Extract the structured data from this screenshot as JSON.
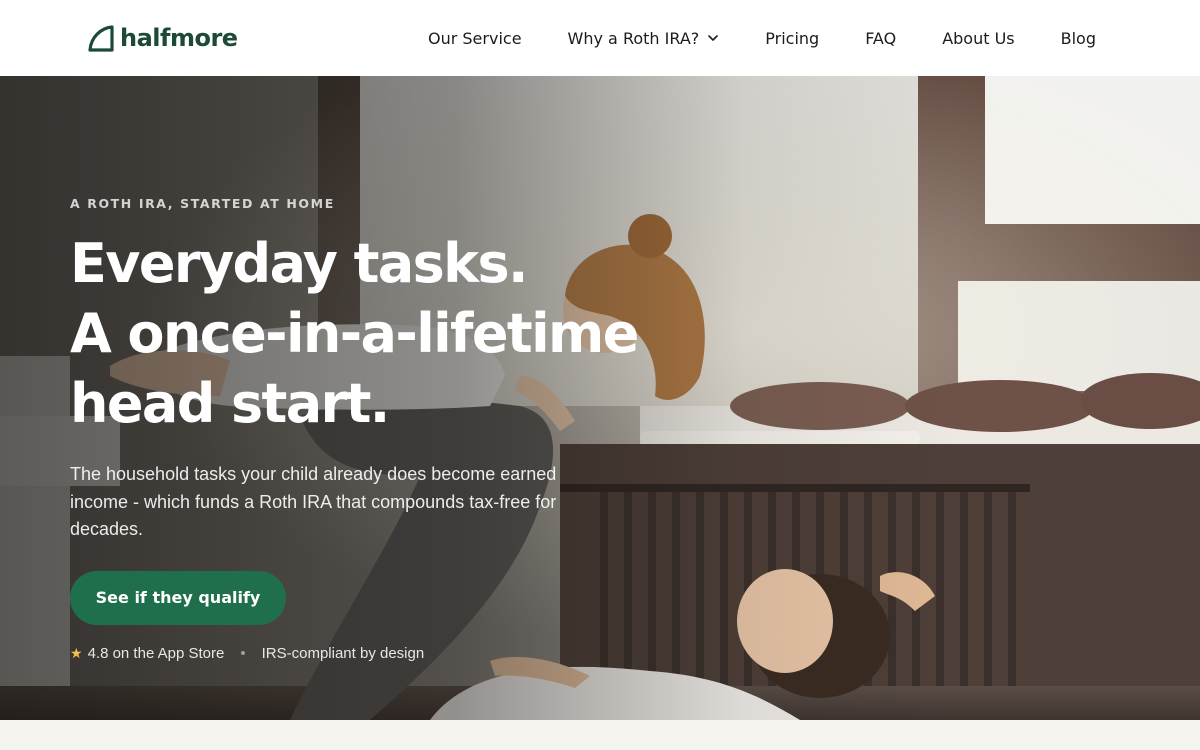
{
  "header": {
    "brand": "halfmore",
    "nav": [
      {
        "label": "Our Service"
      },
      {
        "label": "Why a Roth IRA?",
        "has_dropdown": true
      },
      {
        "label": "Pricing"
      },
      {
        "label": "FAQ"
      },
      {
        "label": "About Us"
      },
      {
        "label": "Blog"
      }
    ]
  },
  "hero": {
    "eyebrow": "A ROTH IRA, STARTED AT HOME",
    "headline": [
      "Everyday tasks.",
      "A once-in-a-lifetime",
      "head start."
    ],
    "subcopy": "The household tasks your child already does become earned income - which funds a Roth IRA that compounds tax-free for decades.",
    "cta_label": "See if they qualify",
    "rating_text": "4.8 on the App Store",
    "compliance_text": "IRS-compliant by design"
  },
  "icons": {
    "logo": "leaf-logo-icon",
    "dropdown": "chevron-down-icon",
    "rating": "star-icon"
  },
  "colors": {
    "brand": "#1d4a36",
    "cta": "#1f6e4c",
    "star": "#f5c04a",
    "page_background": "#f6f4ef"
  }
}
